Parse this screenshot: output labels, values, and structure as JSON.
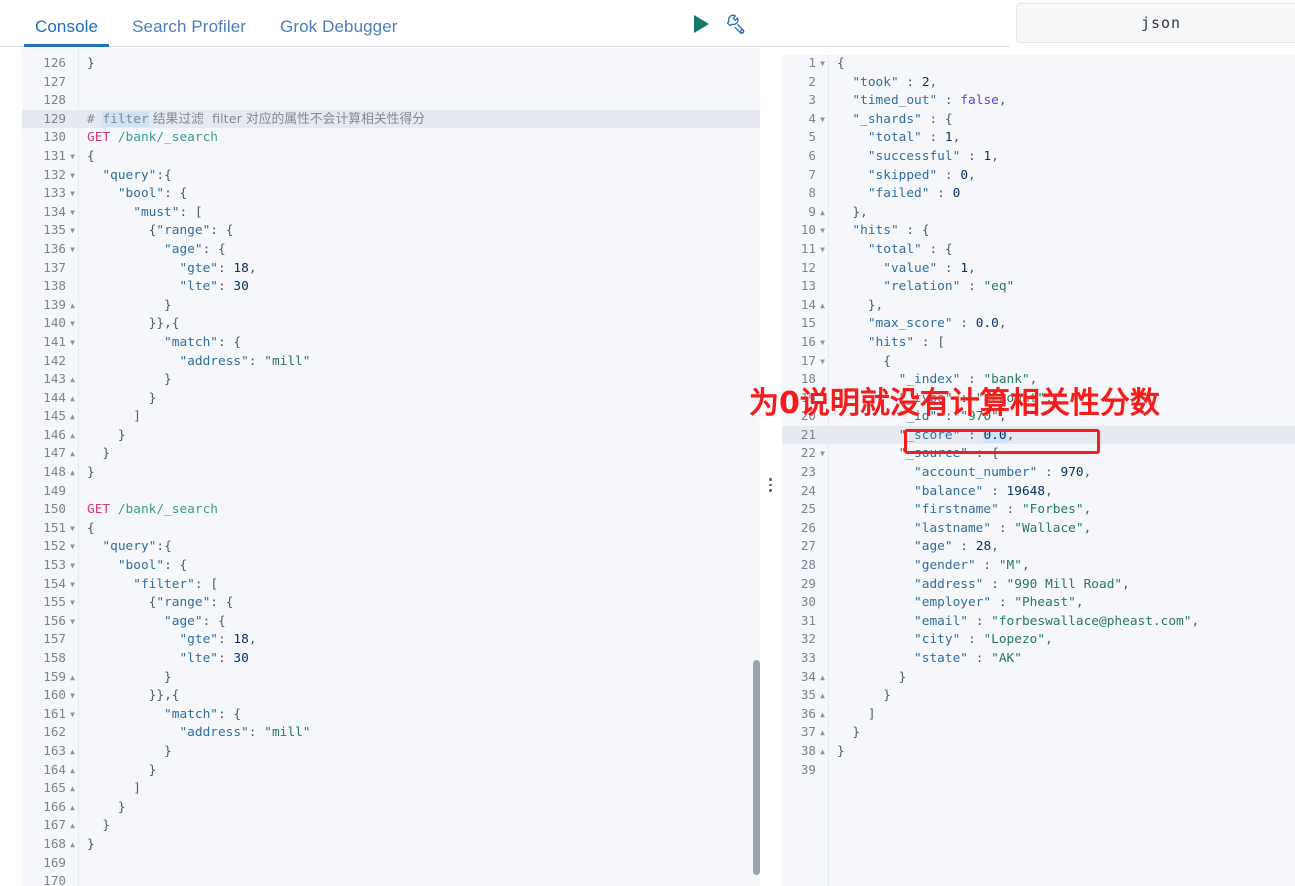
{
  "header": {
    "tabs": [
      {
        "label": "Console",
        "active": true
      },
      {
        "label": "Search Profiler",
        "active": false
      },
      {
        "label": "Grok Debugger",
        "active": false
      }
    ],
    "json_pill_label": "json"
  },
  "toolbar": {
    "run_icon": "play-icon",
    "wrench_icon": "wrench-icon"
  },
  "annotation": {
    "red_text": "为0说明就没有计算相关性分数",
    "red_color": "#f41c1c",
    "highlighted_line": "\"_score\" : 0.0,"
  },
  "editor": {
    "first_line_number": 126,
    "active_line_number": 129,
    "lines": [
      {
        "n": 126,
        "text": "}",
        "fold": ""
      },
      {
        "n": 127,
        "text": "",
        "fold": ""
      },
      {
        "n": 128,
        "text": "",
        "fold": ""
      },
      {
        "n": 129,
        "text": "# filter 结果过滤  filter 对应的属性不会计算相关性得分",
        "fold": "",
        "active": true
      },
      {
        "n": 130,
        "text": "GET /bank/_search",
        "fold": ""
      },
      {
        "n": 131,
        "text": "{",
        "fold": "down"
      },
      {
        "n": 132,
        "text": "  \"query\":{",
        "fold": "down"
      },
      {
        "n": 133,
        "text": "    \"bool\": {",
        "fold": "down"
      },
      {
        "n": 134,
        "text": "      \"must\": [",
        "fold": "down"
      },
      {
        "n": 135,
        "text": "        {\"range\": {",
        "fold": "down"
      },
      {
        "n": 136,
        "text": "          \"age\": {",
        "fold": "down"
      },
      {
        "n": 137,
        "text": "            \"gte\": 18,",
        "fold": ""
      },
      {
        "n": 138,
        "text": "            \"lte\": 30",
        "fold": ""
      },
      {
        "n": 139,
        "text": "          }",
        "fold": "up"
      },
      {
        "n": 140,
        "text": "        }},{",
        "fold": "down"
      },
      {
        "n": 141,
        "text": "          \"match\": {",
        "fold": "down"
      },
      {
        "n": 142,
        "text": "            \"address\": \"mill\"",
        "fold": ""
      },
      {
        "n": 143,
        "text": "          }",
        "fold": "up"
      },
      {
        "n": 144,
        "text": "        }",
        "fold": "up"
      },
      {
        "n": 145,
        "text": "      ]",
        "fold": "up"
      },
      {
        "n": 146,
        "text": "    }",
        "fold": "up"
      },
      {
        "n": 147,
        "text": "  }",
        "fold": "up"
      },
      {
        "n": 148,
        "text": "}",
        "fold": "up"
      },
      {
        "n": 149,
        "text": "",
        "fold": ""
      },
      {
        "n": 150,
        "text": "GET /bank/_search",
        "fold": ""
      },
      {
        "n": 151,
        "text": "{",
        "fold": "down"
      },
      {
        "n": 152,
        "text": "  \"query\":{",
        "fold": "down"
      },
      {
        "n": 153,
        "text": "    \"bool\": {",
        "fold": "down"
      },
      {
        "n": 154,
        "text": "      \"filter\": [",
        "fold": "down"
      },
      {
        "n": 155,
        "text": "        {\"range\": {",
        "fold": "down"
      },
      {
        "n": 156,
        "text": "          \"age\": {",
        "fold": "down"
      },
      {
        "n": 157,
        "text": "            \"gte\": 18,",
        "fold": ""
      },
      {
        "n": 158,
        "text": "            \"lte\": 30",
        "fold": ""
      },
      {
        "n": 159,
        "text": "          }",
        "fold": "up"
      },
      {
        "n": 160,
        "text": "        }},{",
        "fold": "down"
      },
      {
        "n": 161,
        "text": "          \"match\": {",
        "fold": "down"
      },
      {
        "n": 162,
        "text": "            \"address\": \"mill\"",
        "fold": ""
      },
      {
        "n": 163,
        "text": "          }",
        "fold": "up"
      },
      {
        "n": 164,
        "text": "        }",
        "fold": "up"
      },
      {
        "n": 165,
        "text": "      ]",
        "fold": "up"
      },
      {
        "n": 166,
        "text": "    }",
        "fold": "up"
      },
      {
        "n": 167,
        "text": "  }",
        "fold": "up"
      },
      {
        "n": 168,
        "text": "}",
        "fold": "up"
      },
      {
        "n": 169,
        "text": "",
        "fold": ""
      },
      {
        "n": 170,
        "text": "",
        "fold": ""
      }
    ]
  },
  "response": {
    "lines": [
      {
        "n": 1,
        "text": "{",
        "fold": "down"
      },
      {
        "n": 2,
        "text": "  \"took\" : 2,",
        "fold": ""
      },
      {
        "n": 3,
        "text": "  \"timed_out\" : false,",
        "fold": ""
      },
      {
        "n": 4,
        "text": "  \"_shards\" : {",
        "fold": "down"
      },
      {
        "n": 5,
        "text": "    \"total\" : 1,",
        "fold": ""
      },
      {
        "n": 6,
        "text": "    \"successful\" : 1,",
        "fold": ""
      },
      {
        "n": 7,
        "text": "    \"skipped\" : 0,",
        "fold": ""
      },
      {
        "n": 8,
        "text": "    \"failed\" : 0",
        "fold": ""
      },
      {
        "n": 9,
        "text": "  },",
        "fold": "up"
      },
      {
        "n": 10,
        "text": "  \"hits\" : {",
        "fold": "down"
      },
      {
        "n": 11,
        "text": "    \"total\" : {",
        "fold": "down"
      },
      {
        "n": 12,
        "text": "      \"value\" : 1,",
        "fold": ""
      },
      {
        "n": 13,
        "text": "      \"relation\" : \"eq\"",
        "fold": ""
      },
      {
        "n": 14,
        "text": "    },",
        "fold": "up"
      },
      {
        "n": 15,
        "text": "    \"max_score\" : 0.0,",
        "fold": ""
      },
      {
        "n": 16,
        "text": "    \"hits\" : [",
        "fold": "down"
      },
      {
        "n": 17,
        "text": "      {",
        "fold": "down"
      },
      {
        "n": 18,
        "text": "        \"_index\" : \"bank\",",
        "fold": ""
      },
      {
        "n": 19,
        "text": "        \"_type\" : \"account\",",
        "fold": ""
      },
      {
        "n": 20,
        "text": "        \"_id\" : \"970\",",
        "fold": ""
      },
      {
        "n": 21,
        "text": "        \"_score\" : 0.0,",
        "fold": "",
        "active": true
      },
      {
        "n": 22,
        "text": "        \"_source\" : {",
        "fold": "down"
      },
      {
        "n": 23,
        "text": "          \"account_number\" : 970,",
        "fold": ""
      },
      {
        "n": 24,
        "text": "          \"balance\" : 19648,",
        "fold": ""
      },
      {
        "n": 25,
        "text": "          \"firstname\" : \"Forbes\",",
        "fold": ""
      },
      {
        "n": 26,
        "text": "          \"lastname\" : \"Wallace\",",
        "fold": ""
      },
      {
        "n": 27,
        "text": "          \"age\" : 28,",
        "fold": ""
      },
      {
        "n": 28,
        "text": "          \"gender\" : \"M\",",
        "fold": ""
      },
      {
        "n": 29,
        "text": "          \"address\" : \"990 Mill Road\",",
        "fold": ""
      },
      {
        "n": 30,
        "text": "          \"employer\" : \"Pheast\",",
        "fold": ""
      },
      {
        "n": 31,
        "text": "          \"email\" : \"forbeswallace@pheast.com\",",
        "fold": ""
      },
      {
        "n": 32,
        "text": "          \"city\" : \"Lopezo\",",
        "fold": ""
      },
      {
        "n": 33,
        "text": "          \"state\" : \"AK\"",
        "fold": ""
      },
      {
        "n": 34,
        "text": "        }",
        "fold": "up"
      },
      {
        "n": 35,
        "text": "      }",
        "fold": "up"
      },
      {
        "n": 36,
        "text": "    ]",
        "fold": "up"
      },
      {
        "n": 37,
        "text": "  }",
        "fold": "up"
      },
      {
        "n": 38,
        "text": "}",
        "fold": "up"
      },
      {
        "n": 39,
        "text": "",
        "fold": ""
      }
    ]
  }
}
